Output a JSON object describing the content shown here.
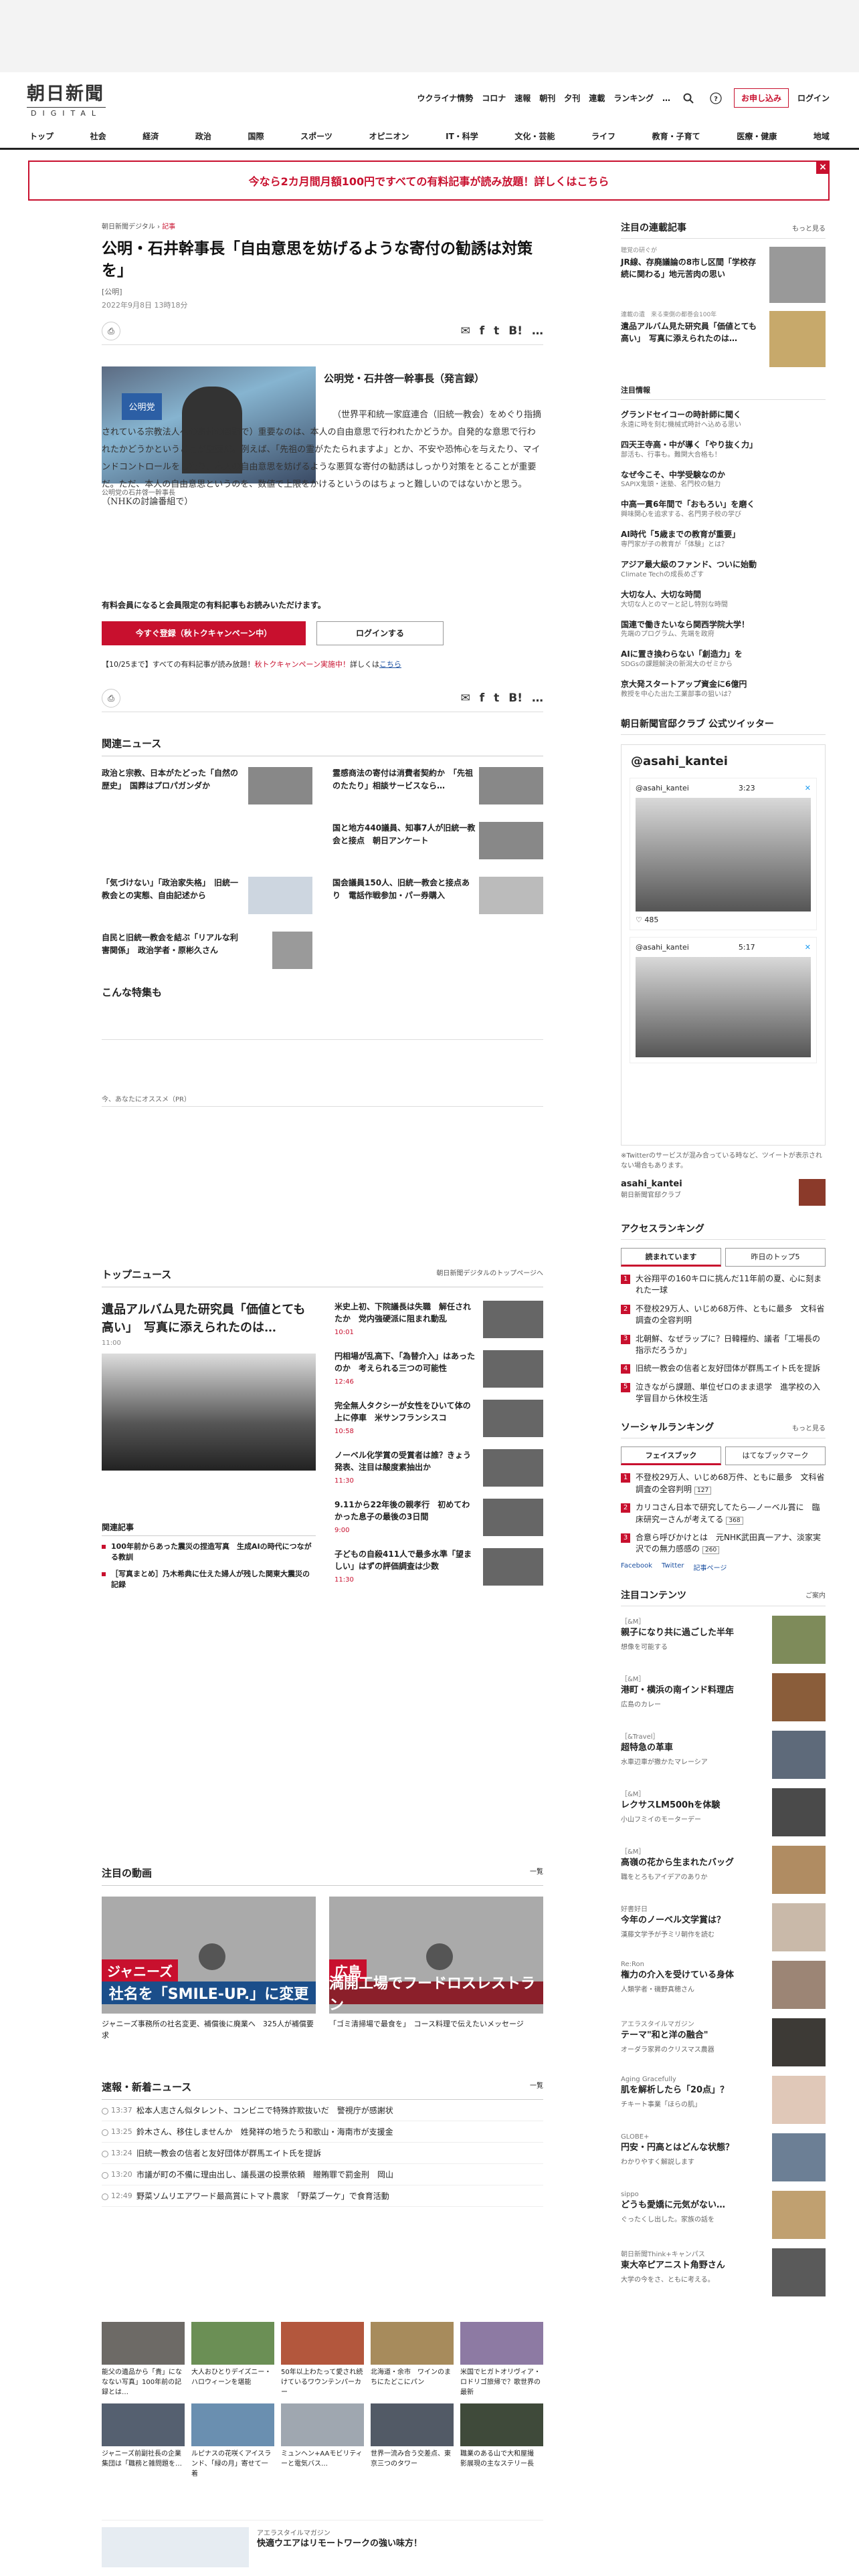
{
  "header": {
    "logo_jp": "朝日新聞",
    "logo_en": "DIGITAL",
    "links": [
      "ウクライナ情勢",
      "コロナ",
      "速報",
      "朝刊",
      "夕刊",
      "連載",
      "ランキング"
    ],
    "more": "…",
    "apply": "お申し込み",
    "login": "ログイン"
  },
  "categories": [
    "トップ",
    "社会",
    "経済",
    "政治",
    "国際",
    "スポーツ",
    "オピニオン",
    "IT・科学",
    "文化・芸能",
    "ライフ",
    "教育・子育て",
    "医療・健康",
    "地域"
  ],
  "banner": {
    "text": "今なら2カ月間月額100円ですべての有料記事が読み放題！詳しくはこちら",
    "close": "×"
  },
  "article": {
    "breadcrumb": "朝日新聞デジタル",
    "crumb_label": "記事",
    "title": "公明・石井幹事長「自由意思を妨げるような寄付の勧誘は対策を」",
    "author": "[公明]",
    "datetime": "2022年9月8日 13時18分",
    "caption": "公明党の石井啓一幹事長",
    "flag": "公明党",
    "headline": "公明党・石井啓一幹事長（発言録）",
    "body": "（世界平和統一家庭連合（旧統一教会）をめぐり指摘されている宗教法人への寄付の問題で）重要なのは、本人の自由意思で行われたかどうか。自発的な意思で行われたかどうかということが重要だ。例えば、「先祖の霊がたたられますよ」とか、不安や恐怖心を与えたり、マインドコントロールをしたり、本人の自由意思を妨げるような悪質な寄付の勧誘はしっかり対策をとることが重要だ。ただ、本人の自由意思というのを、数値で上限をかけるというのはちょっと難しいのではないかと思う。（NHKの討論番組で）",
    "member_text": "有料会員になると会員限定の有料記事もお読みいただけます。",
    "register": "今すぐ登録（秋トクキャンペーン中）",
    "login": "ログインする",
    "notice": "【10/25まで】すべての有料記事が読み放題！",
    "notice_red": "秋トクキャンペーン実施中！",
    "notice_tail": "詳しくは",
    "notice_link": "こちら",
    "share": "B!"
  },
  "related": {
    "heading": "関連ニュース",
    "items": [
      "政治と宗教、日本がたどった「自然の歴史」　国葬はプロパガンダか",
      "霊感商法の寄付は消費者契約か　「先祖のたたり」相談サービスなら…",
      "国と地方440議員、知事7人が旧統一教会と接点　朝日アンケート",
      "",
      "「気づけない」「政治家失格」　旧統一教会との実態、自由記述から",
      "国会議員150人、旧統一教会と接点あり　電話作戦参加・パー券購入",
      "自民と旧統一教会を結ぶ「リアルな利害関係」　政治学者・原彬久さん"
    ],
    "special": "こんな特集も",
    "recommend": "今、あなたにオススメ（PR）"
  },
  "topnews": {
    "heading": "トップニュース",
    "link": "朝日新聞デジタルのトップページへ",
    "lead": "遺品アルバム見た研究員「価値とても高い」　写真に添えられたのは…",
    "lead_time": "11:00",
    "related_h": "関連記事",
    "related": [
      "100年前からあった震災の捏造写真　生成AIの時代につながる教訓",
      "［写真まとめ］乃木希典に仕えた婦人が残した関東大震災の記録"
    ],
    "items": [
      {
        "t": "米史上初、下院議長は失職　解任されたか　党内強硬派に阻まれ動乱",
        "tm": "10:01"
      },
      {
        "t": "円相場が乱高下、「為替介入」はあったのか　考えられる三つの可能性",
        "tm": "12:46"
      },
      {
        "t": "完全無人タクシーが女性をひいて体の上に停車　米サンフランシスコ",
        "tm": "10:58"
      },
      {
        "t": "ノーベル化学賞の受賞者は誰？きょう発表、注目は酸度素抽出か",
        "tm": "11:30"
      },
      {
        "t": "9.11から22年後の親孝行　初めてわかった息子の最後の3日間",
        "tm": "9:00"
      },
      {
        "t": "子どもの自殺411人で最多水準「望ましい」はずの評価調査は少数",
        "tm": "11:30"
      }
    ]
  },
  "video": {
    "heading": "注目の動画",
    "link": "一覧",
    "items": [
      {
        "band": "社名を「SMILE-UP.」に変更",
        "tag": "ジャニーズ",
        "c": "ジャニーズ事務所の社名変更、補償後に廃業へ　325人が補償要求"
      },
      {
        "band": "満開工場でフードロスレストラン",
        "tag": "広島",
        "c": "「ゴミ清掃場で最食を」　コース料理で伝えたいメッセージ"
      }
    ]
  },
  "breaking": {
    "heading": "速報・新着ニュース",
    "link": "一覧",
    "items": [
      {
        "tm": "13:37",
        "t": "松本人志さん似タレント、コンビニで特殊詐欺抜いだ　警視庁が感謝状"
      },
      {
        "tm": "13:25",
        "t": "鈴木さん、移住しませんか　姓発祥の地うたう和歌山・海南市が支援金"
      },
      {
        "tm": "13:24",
        "t": "旧統一教会の信者と友好団体が群馬エイト氏を提訴"
      },
      {
        "tm": "13:20",
        "t": "市議が町の不備に理由出し、議長選の投票依頼　贈賄罪で罰金刑　岡山"
      },
      {
        "tm": "12:49",
        "t": "野菜ソムリエアワード最高賞にトマト農家　「野菜ブーケ」で食育活動"
      }
    ]
  },
  "grid": [
    "能父の遺品から「貴」にななない写真」100年前の記録とは…",
    "大人おひとりデイズニー・ハロウィーンを堪能",
    "50年以上わたって愛され続けているワウンテンパーカー",
    "北海道・余市　ワインのまちにたどこにパン",
    "米国でヒガトオリヴィア・ロドリゴ旅帰で？歌世界の最新",
    "ジャニーズ前副社長の企業集団は「職務と雑問題を…",
    "ルピナスの花咲くアイスランド、「緑の月」寄せて一着",
    "ミュンヘン+AAモビリティーと電気バス…",
    "世界一流み合う交差点、東京三つのタワー",
    "職業のある山で大和屋撮　影展現の主なステリー長"
  ],
  "adbottom": {
    "label": "アエラスタイルマガジン",
    "t": "快適ウエアはリモートワークの強い味方！"
  },
  "side": {
    "series": {
      "heading": "注目の連載記事",
      "more": "もっと見る",
      "items": [
        {
          "s": "聴覚の研ぐが",
          "t": "JR線、存廃議論の8市し区間「学校存続に関わる」地元苦肉の思い"
        },
        {
          "s": "連載の遺　来る東側の都巻会100年",
          "t": "遺品アルバム見た研究員「価値とても高い」　写真に添えられたのは…"
        }
      ]
    },
    "hot": {
      "heading": "注目情報",
      "items": [
        {
          "t": "グランドセイコーの時計師に聞く",
          "s": "永遠に時を刻む機械式時計へ込める思い"
        },
        {
          "t": "四天王寺高・中が導く「やり抜く力」",
          "s": "部活も、行事も。難関大合格も！"
        },
        {
          "t": "なぜ今こそ、中学受験なのか",
          "s": "SAPIX鬼頭・迷塾、名門校の魅力"
        },
        {
          "t": "中高一貫6年間で「おもろい」を磨く",
          "s": "興味関心を追求する、名門男子校の学び"
        },
        {
          "t": "AI時代「5歳までの教育が重要」",
          "s": "専門家が子の教育が「体験」とは？"
        },
        {
          "t": "アジア最大級のファンド、ついに始動",
          "s": "Climate Techの成長めざす"
        },
        {
          "t": "大切な人、大切な時間",
          "s": "大切な人とのマーと記し特別な時間"
        },
        {
          "t": "国連で働きたいなら関西学院大学！",
          "s": "先端のプログラム、先端を政府"
        },
        {
          "t": "AIに置き換わらない「創造力」を",
          "s": "SDGsの課題解決の新潟大のゼミから"
        },
        {
          "t": "京大発スタートアップ資金に6億円",
          "s": "教授を中心た出た工業部事の狙いは？"
        }
      ]
    },
    "twitter": {
      "heading": "朝日新聞官邸クラブ 公式ツイッター",
      "account": "@asahi_kantei",
      "name": "asahi_kantei",
      "club": "朝日新聞官邸クラブ",
      "note": "※Twitterのサービスが混み合っている時など、ツイートが表示されない場合もあります。",
      "t1": "3:23",
      "t2": "5:17",
      "likes": "485"
    },
    "access": {
      "heading": "アクセスランキング",
      "tab1": "読まれています",
      "tab2": "昨日のトップ5",
      "items": [
        "大谷翔平の160キロに挑んだ11年前の夏、心に刻まれた一球",
        "不登校29万人、いじめ68万件、ともに最多　文科省調査の全容判明",
        "北朝鮮、なぜラップに？日韓糧約、議者「工場長の指示だろうか」",
        "旧統一教会の信者と友好団体が群馬エイト氏を提訴",
        "泣きながら課題、単位ゼロのまま退学　進学校の入学冒目から休校生活"
      ]
    },
    "social": {
      "heading": "ソーシャルランキング",
      "more": "もっと見る",
      "tab1": "フェイスブック",
      "tab2": "はてなブックマーク",
      "items": [
        {
          "t": "不登校29万人、いじめ68万件、ともに最多　文科省調査の全容判明",
          "c": "127"
        },
        {
          "t": "カリコさん日本で研究してたら—ノーベル賞に　臨床研究ーさんが考えてる",
          "c": "368"
        },
        {
          "t": "合意ら呼びかけとは　元NHK武田真一アナ、淡家実沢での無力感感の",
          "c": "260"
        }
      ],
      "fb": "Facebook",
      "tw": "Twitter",
      "info": "記事ページ"
    },
    "contents": {
      "heading": "注目コンテンツ",
      "more": "ご案内",
      "items": [
        {
          "s": "［&M］",
          "t": "親子になり共に過ごした半年",
          "x": "想像を可能する"
        },
        {
          "s": "［&M］",
          "t": "港町・横浜の南インド料理店",
          "x": "広島のカレー"
        },
        {
          "s": "［&Travel］",
          "t": "超特急の革車",
          "x": "水車辺車が撒かたマレーシア"
        },
        {
          "s": "［&M］",
          "t": "レクサスLM500hを体験",
          "x": "小山フミイのモーターデー"
        },
        {
          "s": "［&M］",
          "t": "高嶺の花から生まれたバッグ",
          "x": "職をとろもアイデアのありか"
        },
        {
          "s": "好書好日",
          "t": "今年のノーベル文学賞は？",
          "x": "漢藤文学予が予ミリ朝作を読む"
        },
        {
          "s": "Re:Ron",
          "t": "権力の介入を受けている身体",
          "x": "人類学者・磯野真穂さん"
        },
        {
          "s": "アエラスタイルマガジン",
          "t": "テーマ\"和と洋の融合\"",
          "x": "オーダラ家昇のクリスマス農器"
        },
        {
          "s": "Aging Gracefully",
          "t": "肌を解析したら「20点」？",
          "x": "チキート事業「ほらの肌」"
        },
        {
          "s": "GLOBE+",
          "t": "円安・円高とはどんな状態？",
          "x": "わかりやすく解説します"
        },
        {
          "s": "sippo",
          "t": "どうも愛嬌に元気がない…",
          "x": "ぐったくし出した。家族の話を"
        },
        {
          "s": "朝日新聞Think+キャンパス",
          "t": "東大卒ピアニスト角野さん",
          "x": "大学の今をさ、ともに考える。"
        }
      ]
    }
  }
}
